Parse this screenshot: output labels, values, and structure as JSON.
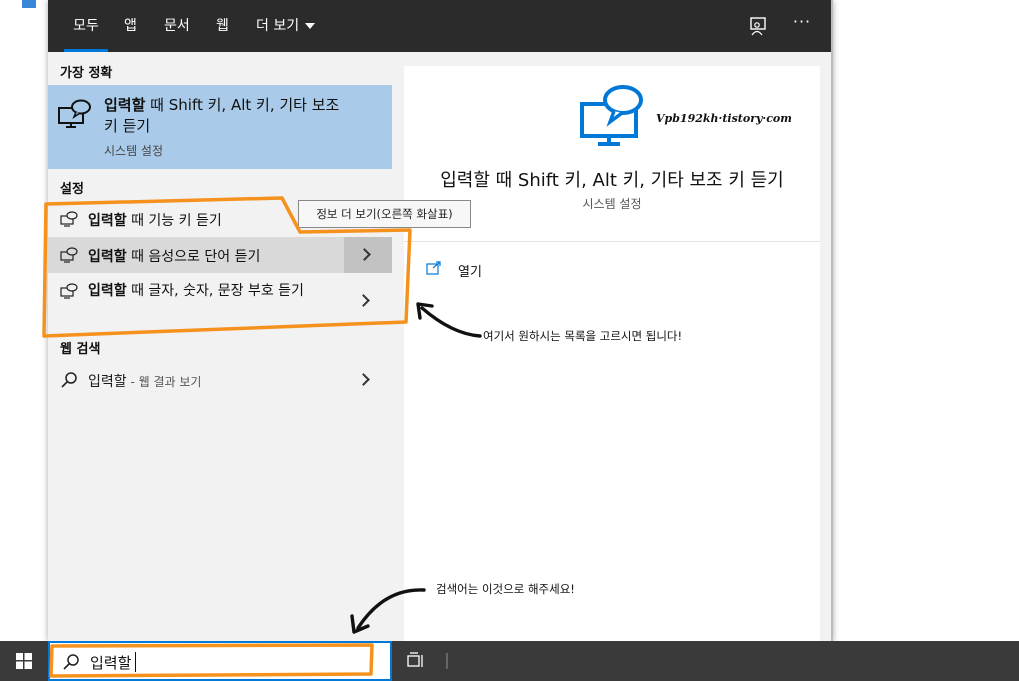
{
  "tabs": [
    {
      "label": "모두"
    },
    {
      "label": "앱"
    },
    {
      "label": "문서"
    },
    {
      "label": "웹"
    },
    {
      "label": "더 보기"
    }
  ],
  "sections": {
    "best_match": "가장 정확",
    "settings": "설정",
    "web_search": "웹 검색"
  },
  "best_match": {
    "title_bold": "입력할",
    "title_rest": " 때 Shift 키, Alt 키, 기타 보조 키 듣기",
    "subtitle": "시스템 설정"
  },
  "settings_items": [
    {
      "bold": "입력할",
      "rest": " 때 기능 키 듣기"
    },
    {
      "bold": "입력할",
      "rest": " 때 음성으로 단어 듣기"
    },
    {
      "bold": "입력할",
      "rest": " 때 글자, 숫자, 문장 부호 듣기"
    }
  ],
  "tooltip": "정보 더 보기(오른쪽 화살표)",
  "web_item": {
    "query": "입력할",
    "suffix": " - 웹 결과 보기"
  },
  "preview": {
    "watermark": "Vpb192kh·tistory·com",
    "title": "입력할 때 Shift 키, Alt 키, 기타 보조 키 듣기",
    "subtitle": "시스템 설정",
    "open_label": "열기"
  },
  "annotations": {
    "choose_note": "여기서 원하시는 목록을 고르시면 됩니다!",
    "search_note": "검색어는 이것으로 해주세요!"
  },
  "search_box": {
    "query": "입력할"
  },
  "colors": {
    "accent": "#0078d7",
    "highlight": "#a9cbe9",
    "annotation": "#f5921e"
  }
}
